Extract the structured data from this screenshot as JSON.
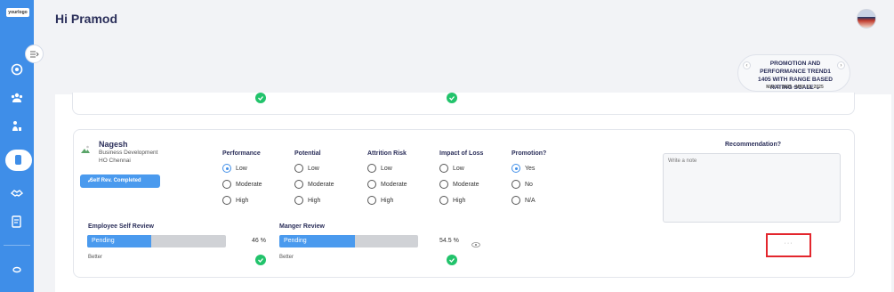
{
  "app": {
    "logo_text": "yourlogo"
  },
  "header": {
    "greeting": "Hi Pramod"
  },
  "period": {
    "title": "PROMOTION AND PERFORMANCE TREND1 1405 WITH RANGE BASED RATING SCALE",
    "chevron": "⌄",
    "dates": "MAY 1, 2025 - MAY 31, 2025",
    "prev_icon": "‹",
    "next_icon": "›"
  },
  "employee": {
    "name": "Nagesh",
    "department": "Business Development",
    "location": "HO Chennai",
    "status_badge": "Self Rev. Completed"
  },
  "ratings": {
    "performance": {
      "label": "Performance",
      "options": [
        "Low",
        "Moderate",
        "High"
      ],
      "selected": "Low"
    },
    "potential": {
      "label": "Potential",
      "options": [
        "Low",
        "Moderate",
        "High"
      ],
      "selected": null
    },
    "attrition": {
      "label": "Attrition Risk",
      "options": [
        "Low",
        "Moderate",
        "High"
      ],
      "selected": null
    },
    "impact": {
      "label": "Impact of Loss",
      "options": [
        "Low",
        "Moderate",
        "High"
      ],
      "selected": null
    },
    "promotion": {
      "label": "Promotion?",
      "options": [
        "Yes",
        "No",
        "N/A"
      ],
      "selected": "Yes"
    }
  },
  "recommendation": {
    "label": "Recommendation?",
    "placeholder": "Write a note"
  },
  "self_review": {
    "label": "Employee Self Review",
    "status": "Pending",
    "progress": 0.46,
    "percent_text": "46 %",
    "trend": "Better"
  },
  "manager_review": {
    "label": "Manger Review",
    "status": "Pending",
    "progress": 0.545,
    "percent_text": "54.5 %",
    "trend": "Better"
  },
  "actions": {
    "more_label": "···"
  },
  "colors": {
    "sidebar": "#3f8ee8",
    "accent": "#4a9aee",
    "success": "#22c36b",
    "highlight": "#e3262d"
  }
}
